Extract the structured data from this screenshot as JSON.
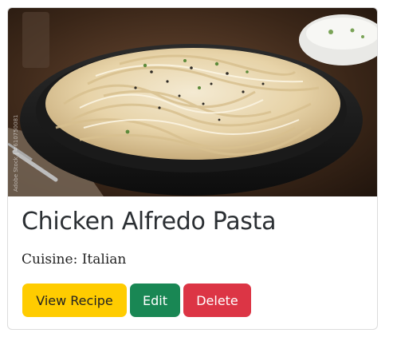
{
  "recipe": {
    "title": "Chicken Alfredo Pasta",
    "cuisine": "Cuisine: Italian",
    "image_alt": "Chicken Alfredo Pasta"
  },
  "actions": {
    "view_label": "View Recipe",
    "edit_label": "Edit",
    "delete_label": "Delete"
  },
  "colors": {
    "view_button": "#ffcc00",
    "edit_button": "#198754",
    "delete_button": "#dc3545"
  }
}
